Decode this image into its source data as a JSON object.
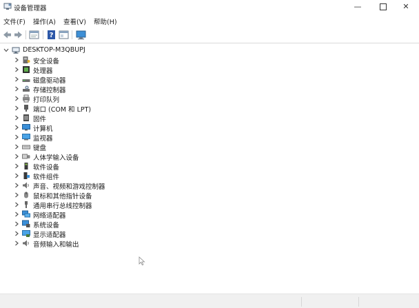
{
  "window": {
    "title": "设备管理器",
    "minimize": "—",
    "close": "✕"
  },
  "menu": [
    "文件(F)",
    "操作(A)",
    "查看(V)",
    "帮助(H)"
  ],
  "tree": {
    "root": "DESKTOP-M3QBUPJ",
    "items": [
      {
        "label": "安全设备",
        "icon": "security-device-icon"
      },
      {
        "label": "处理器",
        "icon": "processor-icon"
      },
      {
        "label": "磁盘驱动器",
        "icon": "disk-drive-icon"
      },
      {
        "label": "存储控制器",
        "icon": "storage-controller-icon"
      },
      {
        "label": "打印队列",
        "icon": "printer-icon"
      },
      {
        "label": "端口 (COM 和 LPT)",
        "icon": "port-icon"
      },
      {
        "label": "固件",
        "icon": "firmware-icon"
      },
      {
        "label": "计算机",
        "icon": "computer-icon"
      },
      {
        "label": "监视器",
        "icon": "monitor-icon"
      },
      {
        "label": "键盘",
        "icon": "keyboard-icon"
      },
      {
        "label": "人体学输入设备",
        "icon": "hid-icon"
      },
      {
        "label": "软件设备",
        "icon": "software-device-icon"
      },
      {
        "label": "软件组件",
        "icon": "software-component-icon"
      },
      {
        "label": "声音、视频和游戏控制器",
        "icon": "speaker-icon"
      },
      {
        "label": "鼠标和其他指针设备",
        "icon": "mouse-icon"
      },
      {
        "label": "通用串行总线控制器",
        "icon": "usb-icon"
      },
      {
        "label": "网络适配器",
        "icon": "network-adapter-icon"
      },
      {
        "label": "系统设备",
        "icon": "system-device-icon"
      },
      {
        "label": "显示适配器",
        "icon": "display-adapter-icon"
      },
      {
        "label": "音频输入和输出",
        "icon": "audio-io-icon"
      }
    ]
  }
}
